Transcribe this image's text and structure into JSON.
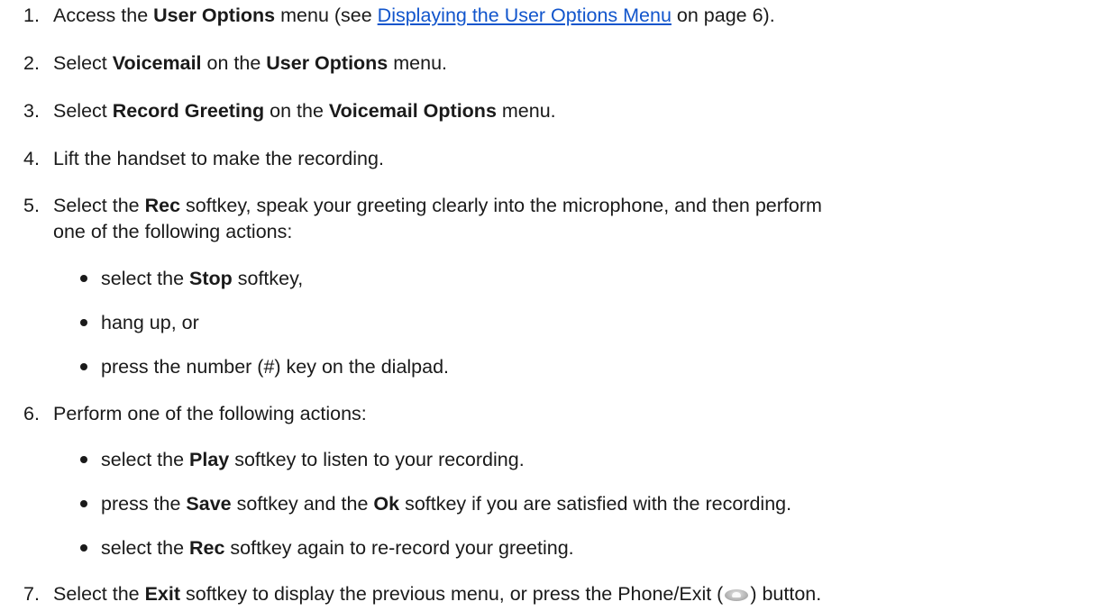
{
  "steps": [
    {
      "num": "1.",
      "parts": [
        "Access the ",
        "User Options",
        " menu (see ",
        "Displaying the User Options Menu",
        " on page 6)."
      ]
    },
    {
      "num": "2.",
      "parts": [
        "Select ",
        "Voicemail",
        " on the ",
        "User Options",
        " menu."
      ]
    },
    {
      "num": "3.",
      "parts": [
        "Select ",
        "Record Greeting",
        " on the ",
        "Voicemail Options",
        " menu."
      ]
    },
    {
      "num": "4.",
      "parts": [
        "Lift the handset to make the recording."
      ]
    },
    {
      "num": "5.",
      "parts": [
        "Select the ",
        "Rec",
        " softkey, speak your greeting clearly into the microphone, and then perform"
      ],
      "cont": "one of the following actions:",
      "bullets": [
        [
          "select the ",
          "Stop",
          " softkey,"
        ],
        [
          "hang up, or"
        ],
        [
          "press the number (#) key on the dialpad."
        ]
      ]
    },
    {
      "num": "6.",
      "parts": [
        "Perform one of the following actions:"
      ],
      "bullets": [
        [
          "select the ",
          "Play",
          " softkey to listen to your recording."
        ],
        [
          "press the ",
          "Save",
          " softkey and the ",
          "Ok",
          " softkey if you are satisfied with the recording."
        ],
        [
          "select the ",
          "Rec",
          " softkey again to re-record your greeting."
        ]
      ]
    },
    {
      "num": "7.",
      "parts": [
        "Select the ",
        "Exit",
        " softkey to display the previous menu, or press the Phone/Exit (",
        ") button."
      ]
    }
  ],
  "icons": {
    "phone_exit": "phone-exit-button-icon"
  },
  "colors": {
    "text": "#1a1a1a",
    "link": "#1155cc"
  }
}
